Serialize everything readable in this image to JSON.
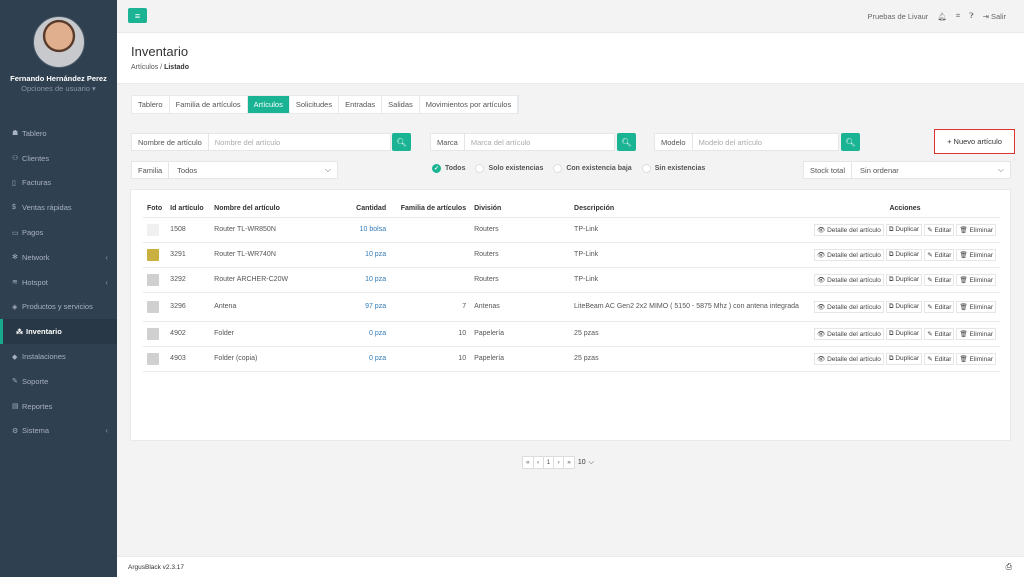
{
  "user": {
    "name": "Fernando Hernández Perez",
    "options": "Opciones de usuario"
  },
  "sidebar": {
    "items": [
      {
        "icon": "dashboard-icon",
        "glyph": "☗",
        "label": "Tablero",
        "chev": ""
      },
      {
        "icon": "users-icon",
        "glyph": "⚇",
        "label": "Clientes",
        "chev": ""
      },
      {
        "icon": "file-icon",
        "glyph": "▯",
        "label": "Facturas",
        "chev": ""
      },
      {
        "icon": "dollar-icon",
        "glyph": "$",
        "label": "Ventas rápidas",
        "chev": ""
      },
      {
        "icon": "card-icon",
        "glyph": "▭",
        "label": "Pagos",
        "chev": ""
      },
      {
        "icon": "network-icon",
        "glyph": "✻",
        "label": "Network",
        "chev": "‹"
      },
      {
        "icon": "wifi-icon",
        "glyph": "≋",
        "label": "Hotspot",
        "chev": "‹"
      },
      {
        "icon": "tag-icon",
        "glyph": "◈",
        "label": "Productos y servicios",
        "chev": ""
      },
      {
        "icon": "cubes-icon",
        "glyph": "⁂",
        "label": "Inventario",
        "chev": ""
      },
      {
        "icon": "install-icon",
        "glyph": "◆",
        "label": "Instalaciones",
        "chev": ""
      },
      {
        "icon": "wrench-icon",
        "glyph": "✎",
        "label": "Soporte",
        "chev": ""
      },
      {
        "icon": "report-icon",
        "glyph": "▤",
        "label": "Reportes",
        "chev": ""
      },
      {
        "icon": "cogs-icon",
        "glyph": "⚙",
        "label": "Sistema",
        "chev": "‹"
      }
    ]
  },
  "topbar": {
    "account": "Pruebas de Livaur",
    "logout": "Salir"
  },
  "page": {
    "title": "Inventario",
    "crumb_parent": "Artículos /",
    "crumb_current": "Listado"
  },
  "tabs": [
    "Tablero",
    "Familia de artículos",
    "Artículos",
    "Solicitudes",
    "Entradas",
    "Salidas",
    "Movimientos por artículos"
  ],
  "filters": {
    "name_label": "Nombre de artículo",
    "name_placeholder": "Nombre del artículo",
    "brand_label": "Marca",
    "brand_placeholder": "Marca del artículo",
    "model_label": "Modelo",
    "model_placeholder": "Modelo del artículo",
    "new_button": "+ Nuevo artículo",
    "family_label": "Familia",
    "family_value": "Todos",
    "radios": [
      {
        "label": "Todos",
        "checked": true
      },
      {
        "label": "Solo existencias",
        "checked": false
      },
      {
        "label": "Con existencia baja",
        "checked": false
      },
      {
        "label": "Sin existencias",
        "checked": false
      }
    ],
    "stock_label": "Stock total",
    "stock_value": "Sin ordenar"
  },
  "table": {
    "headers": [
      "Foto",
      "Id artículo",
      "Nombre del artículo",
      "Cantidad",
      "Familia de artículos",
      "División",
      "Descripción",
      "Acciones"
    ],
    "actions": [
      "Detalle del artículo",
      "Duplicar",
      "Editar",
      "Eliminar"
    ],
    "rows": [
      {
        "photo": "#f0f0f0",
        "id": "1508",
        "name": "Router TL-WR850N",
        "qty": "10 bolsa",
        "family": "",
        "division": "Routers",
        "desc": "TP-Link"
      },
      {
        "photo": "#c9b040",
        "id": "3291",
        "name": "Router TL-WR740N",
        "qty": "10 pza",
        "family": "",
        "division": "Routers",
        "desc": "TP-Link"
      },
      {
        "photo": "#d0d0d0",
        "id": "3292",
        "name": "Router ARCHER-C20W",
        "qty": "10 pza",
        "family": "",
        "division": "Routers",
        "desc": "TP-Link"
      },
      {
        "photo": "#d0d0d0",
        "id": "3296",
        "name": "Antena",
        "qty": "97 pza",
        "family": "7",
        "division": "Antenas",
        "desc": "LiteBeam AC Gen2 2x2 MIMO ( 5150 - 5875 Mhz ) con antena integrada"
      },
      {
        "photo": "#d0d0d0",
        "id": "4902",
        "name": "Folder",
        "qty": "0 pza",
        "family": "10",
        "division": "Papelería",
        "desc": "25 pzas"
      },
      {
        "photo": "#d0d0d0",
        "id": "4903",
        "name": "Folder (copia)",
        "qty": "0 pza",
        "family": "10",
        "division": "Papelería",
        "desc": "25 pzas"
      }
    ]
  },
  "pagination": {
    "first": "«",
    "prev": "‹",
    "page": "1",
    "next": "›",
    "last": "»",
    "size": "10"
  },
  "footer": {
    "version": "ArgusBlack v2.3.17"
  },
  "colors": {
    "accent": "#1ab394",
    "sidebar": "#2f4050",
    "highlight": "#e03333"
  }
}
